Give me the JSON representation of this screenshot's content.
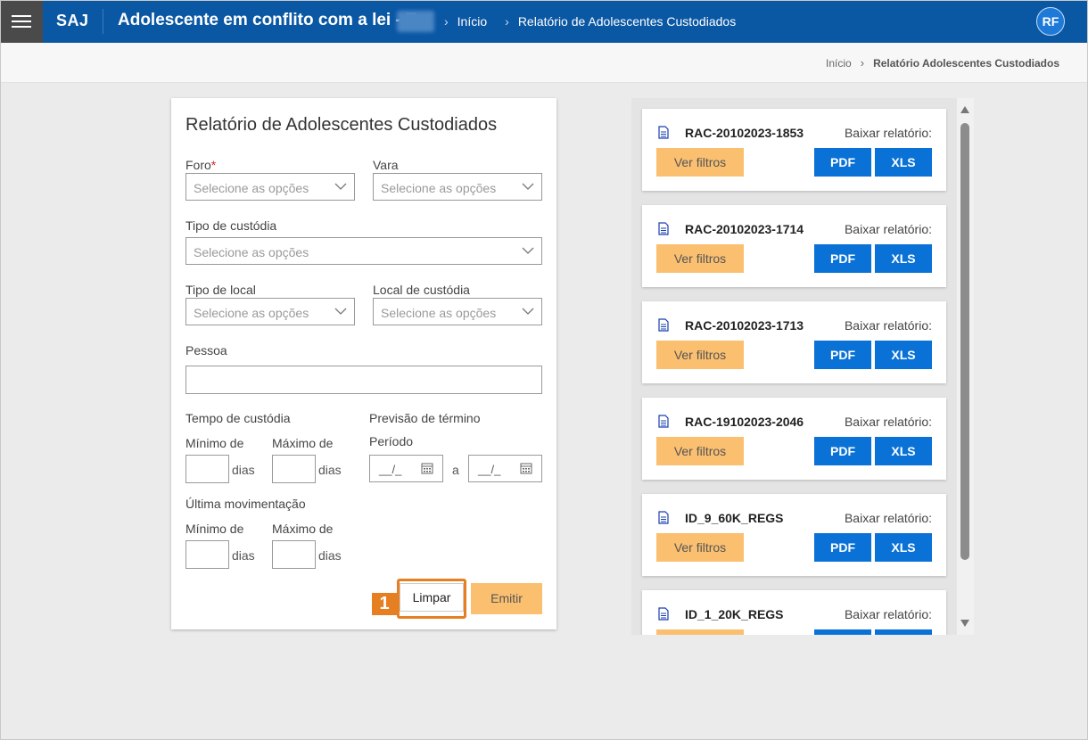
{
  "header": {
    "logo": "SAJ",
    "app_title": "Adolescente em conflito com a lei - T",
    "breadcrumbs": [
      "Início",
      "Relatório de Adolescentes Custodiados"
    ],
    "avatar_initials": "RF",
    "color": "#0a57a4"
  },
  "breadcrumb_bar": {
    "items": [
      "Início",
      "Relatório Adolescentes Custodiados"
    ]
  },
  "form": {
    "title": "Relatório de Adolescentes Custodiados",
    "foro": {
      "label": "Foro",
      "required_mark": "*",
      "placeholder": "Selecione as opções"
    },
    "vara": {
      "label": "Vara",
      "placeholder": "Selecione as opções"
    },
    "tipo_custodia": {
      "label": "Tipo de custódia",
      "placeholder": "Selecione as opções"
    },
    "tipo_local": {
      "label": "Tipo de local",
      "placeholder": "Selecione as opções"
    },
    "local_custodia": {
      "label": "Local de custódia",
      "placeholder": "Selecione as opções"
    },
    "pessoa": {
      "label": "Pessoa",
      "value": ""
    },
    "tempo_custodia": {
      "label": "Tempo de custódia",
      "min_label": "Mínimo de",
      "max_label": "Máximo de",
      "unit": "dias"
    },
    "previsao_termino": {
      "label": "Previsão de término",
      "periodo_label": "Período",
      "date_placeholder": "__/_",
      "separator": "a"
    },
    "ultima_movimentacao": {
      "label": "Última movimentação",
      "min_label": "Mínimo de",
      "max_label": "Máximo de",
      "unit": "dias"
    },
    "buttons": {
      "limpar": "Limpar",
      "emitir": "Emitir"
    },
    "step_badge": "1"
  },
  "reports": {
    "download_label": "Baixar relatório:",
    "filters_label": "Ver filtros",
    "pdf_label": "PDF",
    "xls_label": "XLS",
    "items": [
      {
        "name": "RAC-20102023-1853"
      },
      {
        "name": "RAC-20102023-1714"
      },
      {
        "name": "RAC-20102023-1713"
      },
      {
        "name": "RAC-19102023-2046"
      },
      {
        "name": "ID_9_60K_REGS"
      },
      {
        "name": "ID_1_20K_REGS"
      }
    ]
  },
  "colors": {
    "primary_blue": "#0a72d6",
    "accent_orange": "#fbbf70",
    "highlight_orange": "#e67e22"
  }
}
